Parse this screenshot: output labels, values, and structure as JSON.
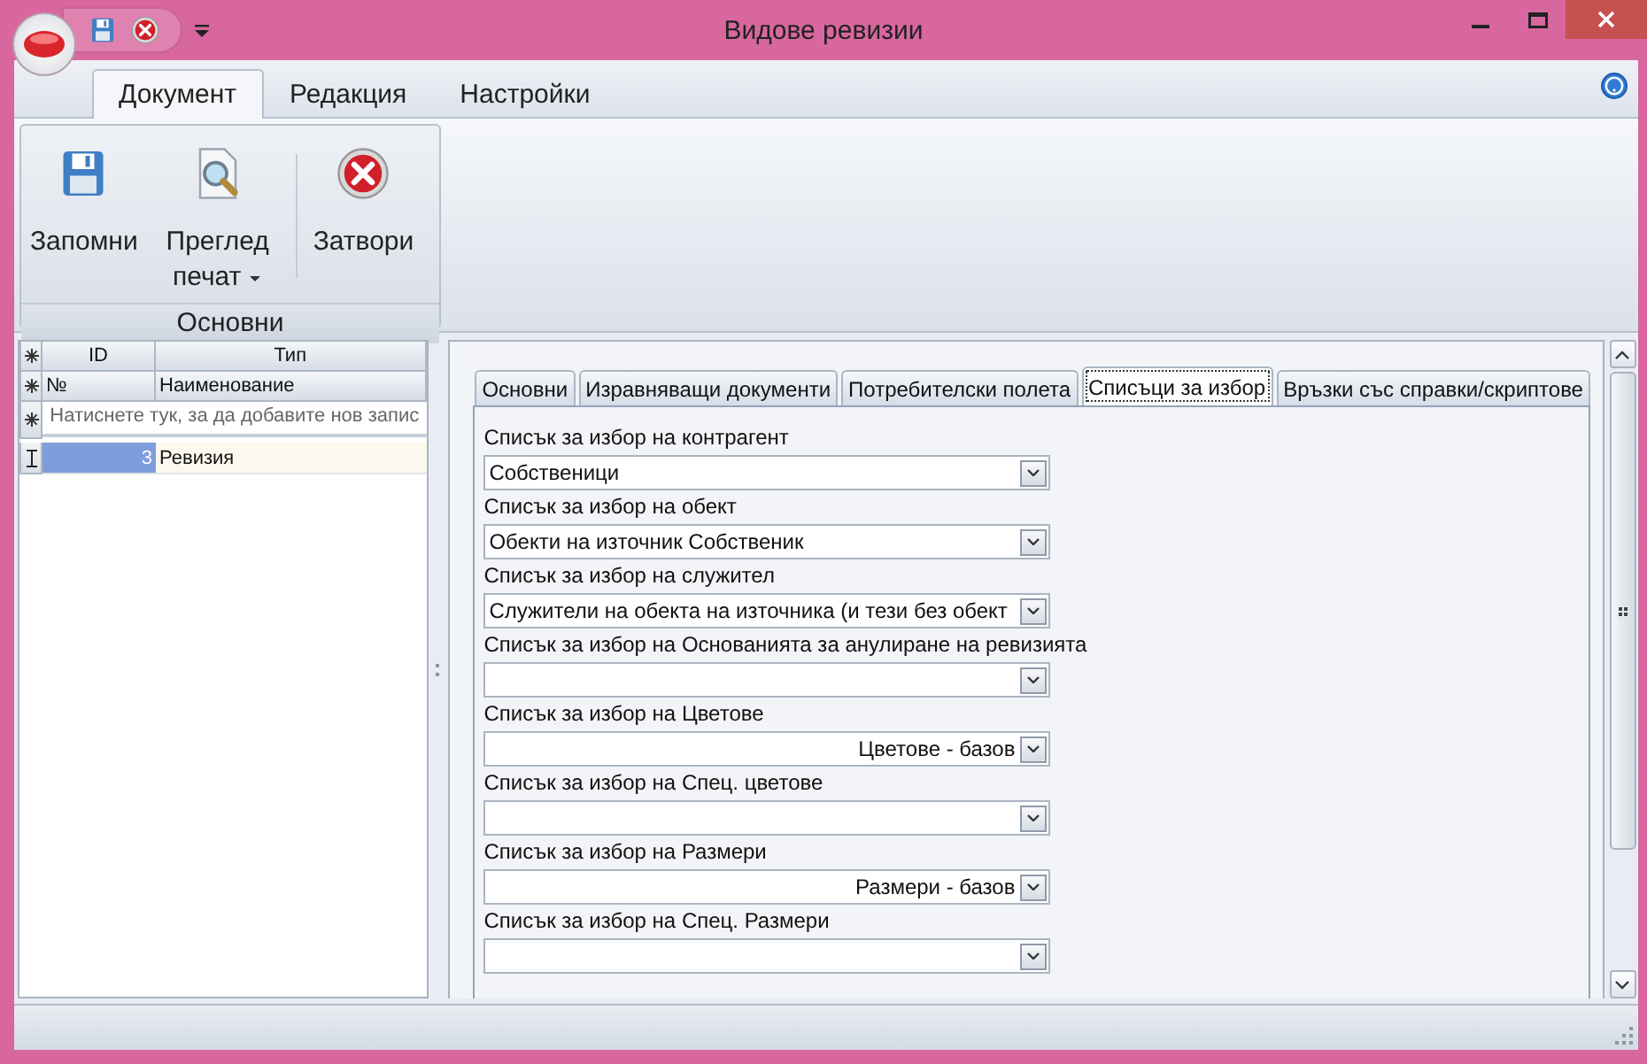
{
  "window": {
    "title": "Видове ревизии"
  },
  "ribbon": {
    "tabs": [
      {
        "label": "Документ",
        "selected": true
      },
      {
        "label": "Редакция",
        "selected": false
      },
      {
        "label": "Настройки",
        "selected": false
      }
    ],
    "group": {
      "label": "Основни",
      "buttons": [
        {
          "kind": "save",
          "label": "Запомни",
          "dropdown": false
        },
        {
          "kind": "preview",
          "label": "Преглед печат",
          "dropdown": true
        },
        {
          "kind": "close",
          "label": "Затвори",
          "dropdown": false
        }
      ]
    }
  },
  "grid": {
    "header_top": [
      "ID",
      "Тип"
    ],
    "header_bottom": [
      "№",
      "Наименование"
    ],
    "new_row_hint": "Натиснете тук, за да добавите нов запис",
    "rows": [
      {
        "id": "3",
        "name": "Ревизия",
        "selected": true
      }
    ]
  },
  "form": {
    "tabs": [
      {
        "label": "Основни",
        "selected": false
      },
      {
        "label": "Изравняващи документи",
        "selected": false
      },
      {
        "label": "Потребителски полета",
        "selected": false
      },
      {
        "label": "Списъци за избор",
        "selected": true
      },
      {
        "label": "Връзки със справки/скриптове",
        "selected": false
      }
    ],
    "fields": [
      {
        "label": "Списък за избор на контрагент",
        "value": "Собственици",
        "right_aligned": false
      },
      {
        "label": "Списък за избор на обект",
        "value": "Обекти на източник Собственик",
        "right_aligned": false
      },
      {
        "label": "Списък за избор на служител",
        "value": "Служители на обекта на източника (и тези без обект",
        "right_aligned": false
      },
      {
        "label": "Списък за избор на Основанията за анулиране на ревизията"
      },
      {
        "label": "Списък за избор на Цветове",
        "value": "Цветове - базов",
        "right_aligned": true
      },
      {
        "label": "Списък за избор на Спец. цветове"
      },
      {
        "label": "Списък за избор на Размери",
        "value": "Размери - базов",
        "right_aligned": true
      },
      {
        "label": "Списък за избор на Спец. Размери"
      }
    ]
  }
}
